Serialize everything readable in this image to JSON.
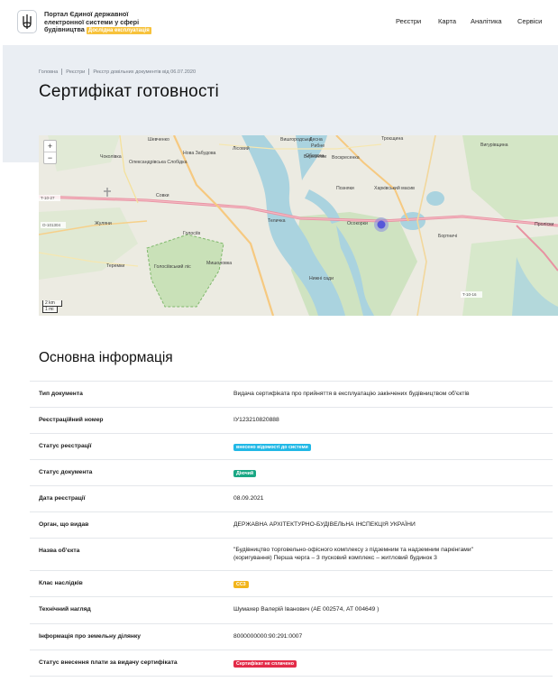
{
  "header": {
    "portal_line1": "Портал Єдиної державної",
    "portal_line2": "електронної системи у сфері",
    "portal_line3": "будівництва",
    "badge": "Дослідна експлуатація",
    "nav": [
      "Реєстри",
      "Карта",
      "Аналітика",
      "Сервіси"
    ]
  },
  "breadcrumbs": [
    "Головна",
    "Реєстри",
    "Реєстр довільних документів від 06.07.2020"
  ],
  "page_title": "Сертифікат готовності",
  "map": {
    "zoom_in": "+",
    "zoom_out": "−",
    "scale_km": "2 km",
    "scale_mi": "1 mi",
    "labels": [
      "Вишгородська",
      "Оболонь",
      "Троєщина",
      "Вигурівщина",
      "Шевченко",
      "Олександрівська Слобідка",
      "Нова Забудова",
      "Лісовий",
      "Рибне",
      "Десна",
      "Воскресенка",
      "Березняки",
      "Позняки",
      "Харківський масив",
      "Осокорки",
      "Бортничі",
      "Жуляни",
      "Голосіїв",
      "Мишоловка",
      "Теремки",
      "Голосіївський ліс",
      "Теличка",
      "Чоколівка",
      "Совки",
      "Проліски",
      "Нижні сади"
    ],
    "road_codes": [
      "T-10-27",
      "O-101304",
      "T-10-16"
    ]
  },
  "section_title": "Основна інформація",
  "rows": [
    {
      "key": "Тип документа",
      "value": "Видача сертифіката про прийняття в експлуатацію закінчених будівництвом об'єктів"
    },
    {
      "key": "Реєстраційний номер",
      "value": "ІУ123210820888"
    },
    {
      "key": "Статус реєстрації",
      "value": "внесено відомості до системи",
      "pill_color": "#21b8e6"
    },
    {
      "key": "Статус документа",
      "value": "Діючий",
      "pill_color": "#1aa784"
    },
    {
      "key": "Дата реєстрації",
      "value": "08.09.2021"
    },
    {
      "key": "Орган, що видав",
      "value": "ДЕРЖАВНА АРХІТЕКТУРНО-БУДІВЕЛЬНА ІНСПЕКЦІЯ УКРАЇНИ"
    },
    {
      "key": "Назва об'єкта",
      "value_line1": "\"Будівництво торговельно-офісного комплексу з підземним та надземним паркінгами\"",
      "value_line2": "(коригування) Перша черга – 3 пусковий комплекс – житловий будинок 3"
    },
    {
      "key": "Клас наслідків",
      "value": "СС3",
      "pill_color": "#f2b51b"
    },
    {
      "key": "Технічний нагляд",
      "value": "Шумахер Валерій Іванович (АЕ 002574, АТ 004649 )"
    },
    {
      "key": "Інформація про земельну ділянку",
      "value": "8000000000:90:291:0007"
    },
    {
      "key": "Статус внесення плати за видачу сертифіката",
      "value": "Сертифікат не сплачено",
      "pill_color": "#e32b48"
    }
  ]
}
